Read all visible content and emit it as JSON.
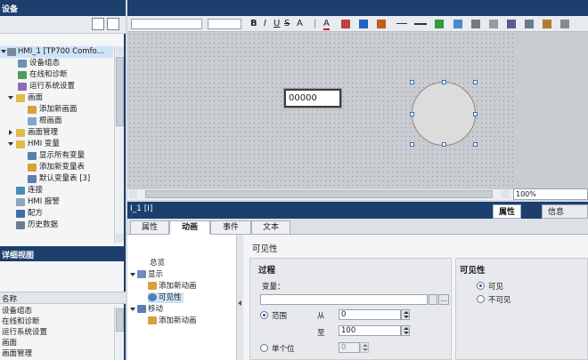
{
  "project_tree": {
    "title": "设备",
    "items": [
      {
        "label": "HMI_1 [TP700 Comfo..."
      },
      {
        "label": "设备组态"
      },
      {
        "label": "在线和诊断"
      },
      {
        "label": "运行系统设置"
      },
      {
        "label": "画面"
      },
      {
        "label": "添加新画面"
      },
      {
        "label": "根画面"
      },
      {
        "label": "画面管理"
      },
      {
        "label": "HMI 变量"
      },
      {
        "label": "显示所有变量"
      },
      {
        "label": "添加新变量表"
      },
      {
        "label": "默认变量表 [3]"
      },
      {
        "label": "连接"
      },
      {
        "label": "HMI 报警"
      },
      {
        "label": "配方"
      },
      {
        "label": "历史数据"
      }
    ]
  },
  "detail_view": {
    "title": "详细视图",
    "column_header": "名称",
    "rows": [
      "设备组态",
      "在线和诊断",
      "运行系统设置",
      "画面",
      "画面管理"
    ]
  },
  "canvas": {
    "io_field_value": "00000",
    "zoom": "100%"
  },
  "inspector": {
    "title": "I_1 [I]",
    "panel_tabs": [
      {
        "label": "属性"
      },
      {
        "label": "信息"
      }
    ],
    "tabs": [
      {
        "label": "属性"
      },
      {
        "label": "动画"
      },
      {
        "label": "事件"
      },
      {
        "label": "文本"
      }
    ],
    "nav": {
      "overview": "总览",
      "display": "显示",
      "add_animation_1": "添加新动画",
      "visibility": "可见性",
      "move": "移动",
      "add_animation_2": "添加新动画"
    },
    "section_title": "可见性",
    "process": {
      "title": "过程",
      "variable_label": "变量：",
      "variable_value": "",
      "range_label": "范围",
      "from_label": "从",
      "from_value": "0",
      "to_label": "至",
      "to_value": "100",
      "single_bit_label": "单个位",
      "single_bit_value": "0"
    },
    "visibility": {
      "title": "可见性",
      "visible": "可见",
      "invisible": "不可见"
    }
  },
  "colors": {
    "title_bar": "#1c3f6e",
    "selection": "#cfe3f7",
    "accent": "#1a5fb4"
  }
}
